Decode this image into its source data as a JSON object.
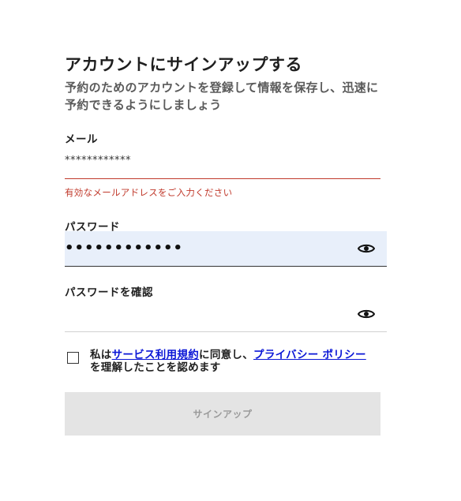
{
  "form": {
    "title": "アカウントにサインアップする",
    "subtitle": "予約のためのアカウントを登録して情報を保存し、迅速に予約できるようにしましょう",
    "email": {
      "label": "メール",
      "value": "************",
      "error": "有効なメールアドレスをご入力ください"
    },
    "password": {
      "label": "パスワード",
      "value": "••••••••••••",
      "toggle_icon": "eye-icon"
    },
    "confirm_password": {
      "label": "パスワードを確認",
      "value": "",
      "toggle_icon": "eye-icon"
    },
    "consent": {
      "prefix": "私は",
      "terms_link": "サービス利用規約",
      "middle": "に同意し、",
      "privacy_link": "プライバシー ポリシー",
      "suffix": "を理解したことを認めます",
      "checked": false
    },
    "submit_label": "サインアップ"
  },
  "colors": {
    "error": "#c0392b",
    "link": "#0a16d6",
    "password_field_bg": "#e8effa",
    "submit_bg": "#e4e4e4"
  }
}
